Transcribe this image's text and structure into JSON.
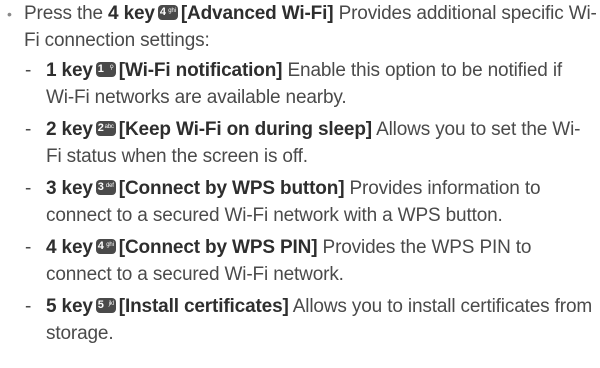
{
  "main": {
    "key": "4 key",
    "key_icon": {
      "digit": "4",
      "letters": "ghi"
    },
    "title": "[Advanced Wi-Fi]",
    "desc": " Provides additional specific Wi-Fi connection settings:"
  },
  "items": [
    {
      "key": "1 key",
      "key_icon": {
        "digit": "1",
        "letters": "⚲"
      },
      "title": "[Wi-Fi notification]",
      "desc": " Enable this option to be notified if Wi-Fi networks are available nearby."
    },
    {
      "key": "2 key",
      "key_icon": {
        "digit": "2",
        "letters": "abc"
      },
      "title": "[Keep Wi-Fi on during sleep]",
      "desc": " Allows you to set the Wi-Fi status when the screen is off."
    },
    {
      "key": "3 key",
      "key_icon": {
        "digit": "3",
        "letters": "def"
      },
      "title": "[Connect by WPS button]",
      "desc": " Provides information to connect to a secured Wi-Fi network with a WPS button."
    },
    {
      "key": "4 key",
      "key_icon": {
        "digit": "4",
        "letters": "ghi"
      },
      "title": "[Connect by WPS PIN]",
      "desc": " Provides the WPS PIN to connect to a secured Wi-Fi network."
    },
    {
      "key": "5 key",
      "key_icon": {
        "digit": "5",
        "letters": "jkl"
      },
      "title": "[Install certificates]",
      "desc": " Allows you to install certificates from storage."
    }
  ]
}
